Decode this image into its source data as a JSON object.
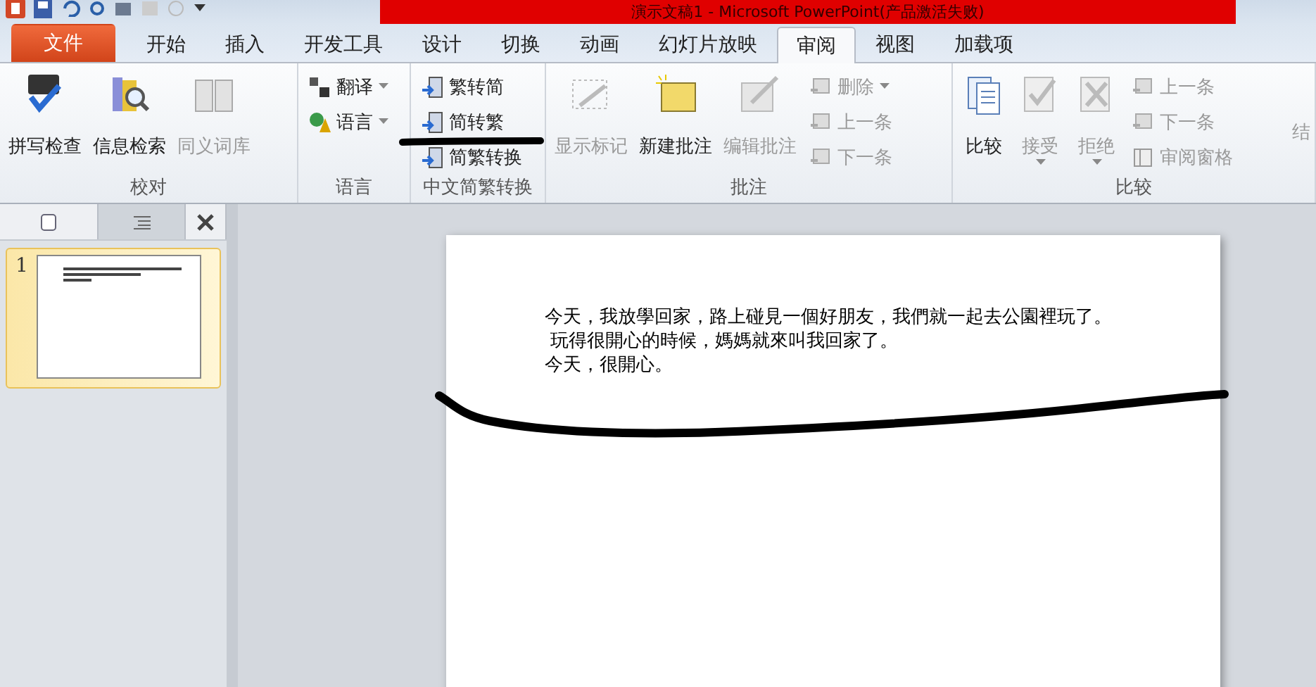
{
  "window": {
    "title": "演示文稿1 - Microsoft PowerPoint(产品激活失败)"
  },
  "tabs": [
    {
      "label": "文件",
      "kind": "file",
      "selected": false
    },
    {
      "label": "开始",
      "kind": "tab",
      "selected": false
    },
    {
      "label": "插入",
      "kind": "tab",
      "selected": false
    },
    {
      "label": "开发工具",
      "kind": "tab",
      "selected": false
    },
    {
      "label": "设计",
      "kind": "tab",
      "selected": false
    },
    {
      "label": "切换",
      "kind": "tab",
      "selected": false
    },
    {
      "label": "动画",
      "kind": "tab",
      "selected": false
    },
    {
      "label": "幻灯片放映",
      "kind": "tab",
      "selected": false
    },
    {
      "label": "审阅",
      "kind": "tab",
      "selected": true
    },
    {
      "label": "视图",
      "kind": "tab",
      "selected": false
    },
    {
      "label": "加载项",
      "kind": "tab",
      "selected": false
    }
  ],
  "ribbon_groups": [
    {
      "label": "校对",
      "items": [
        {
          "kind": "large",
          "label": "拼写检查",
          "disabled": false
        },
        {
          "kind": "large",
          "label": "信息检索",
          "disabled": false
        },
        {
          "kind": "large",
          "label": "同义词库",
          "disabled": true
        }
      ]
    },
    {
      "label": "语言",
      "items": [
        {
          "kind": "column",
          "buttons": [
            {
              "label": "翻译",
              "disabled": false,
              "dropdown": true
            },
            {
              "label": "语言",
              "disabled": false,
              "dropdown": true
            }
          ]
        }
      ]
    },
    {
      "label": "中文简繁转换",
      "items": [
        {
          "kind": "column",
          "buttons": [
            {
              "label": "繁转简",
              "disabled": false
            },
            {
              "label": "简转繁",
              "disabled": false
            },
            {
              "label": "简繁转换",
              "disabled": false
            }
          ]
        }
      ]
    },
    {
      "label": "批注",
      "items": [
        {
          "kind": "large",
          "label": "显示标记",
          "disabled": true
        },
        {
          "kind": "large",
          "label": "新建批注",
          "disabled": false
        },
        {
          "kind": "large",
          "label": "编辑批注",
          "disabled": true
        },
        {
          "kind": "column",
          "buttons": [
            {
              "label": "删除",
              "disabled": true,
              "dropdown": true
            },
            {
              "label": "上一条",
              "disabled": true
            },
            {
              "label": "下一条",
              "disabled": true
            }
          ]
        }
      ]
    },
    {
      "label": "比较",
      "items": [
        {
          "kind": "large",
          "label": "比较",
          "disabled": false
        },
        {
          "kind": "large",
          "label": "接受",
          "disabled": true,
          "dropdown": true
        },
        {
          "kind": "large",
          "label": "拒绝",
          "disabled": true,
          "dropdown": true
        },
        {
          "kind": "column",
          "buttons": [
            {
              "label": "上一条",
              "disabled": true
            },
            {
              "label": "下一条",
              "disabled": true
            },
            {
              "label": "审阅窗格",
              "disabled": true
            }
          ]
        },
        {
          "kind": "cut",
          "label": "结",
          "disabled": true
        }
      ]
    }
  ],
  "slides_panel": {
    "slides": [
      {
        "number": "1",
        "selected": true
      }
    ]
  },
  "slide": {
    "paragraphs": [
      "今天，我放學回家，路上碰見一個好朋友，我們就一起去公園裡玩了。",
      " 玩得很開心的時候，媽媽就來叫我回家了。",
      "今天，很開心。"
    ]
  }
}
